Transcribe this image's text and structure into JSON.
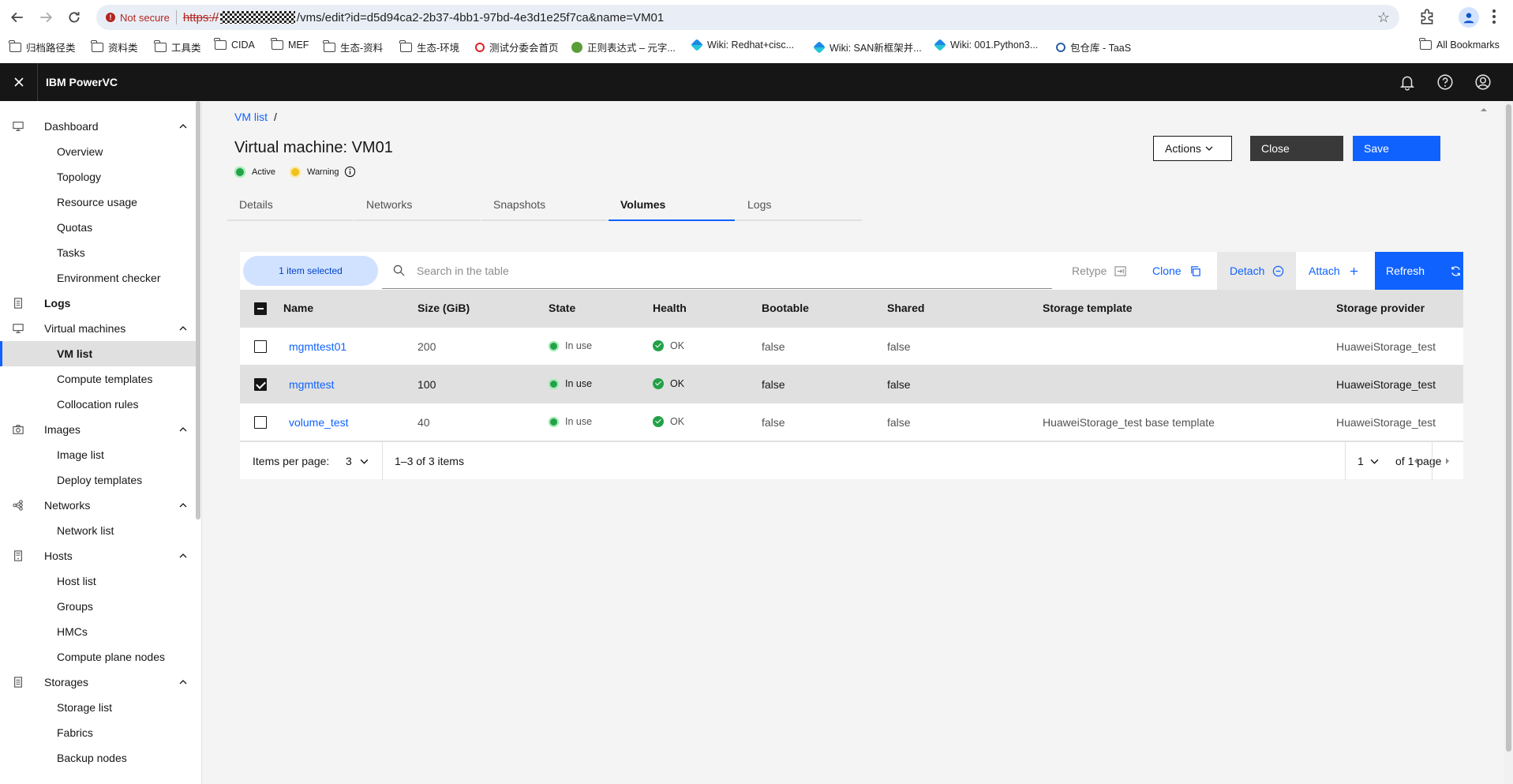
{
  "browser": {
    "not_secure": "Not secure",
    "url_scheme": "https://",
    "url_path": "/vms/edit?id=d5d94ca2-2b37-4bb1-97bd-4e3d1e25f7ca&name=VM01",
    "bookmarks": [
      {
        "label": "归档路径类",
        "icon": "folder-icon"
      },
      {
        "label": "资料类",
        "icon": "folder-icon"
      },
      {
        "label": "工具类",
        "icon": "folder-icon"
      },
      {
        "label": "CIDA",
        "icon": "folder-icon"
      },
      {
        "label": "MEF",
        "icon": "folder-icon"
      },
      {
        "label": "生态-资料",
        "icon": "folder-icon"
      },
      {
        "label": "生态-环境",
        "icon": "folder-icon"
      },
      {
        "label": "测试分委会首页",
        "icon": "huawei-icon"
      },
      {
        "label": "正则表达式 – 元字...",
        "icon": "globe-icon"
      },
      {
        "label": "Wiki: Redhat+cisc...",
        "icon": "wiki-icon"
      },
      {
        "label": "Wiki: SAN新框架并...",
        "icon": "wiki-icon"
      },
      {
        "label": "Wiki: 001.Python3...",
        "icon": "wiki-icon"
      },
      {
        "label": "包仓库 - TaaS",
        "icon": "taas-icon"
      }
    ],
    "all_bookmarks": "All Bookmarks"
  },
  "header": {
    "product": "IBM PowerVC"
  },
  "sidebar": {
    "groups": [
      {
        "label": "Dashboard",
        "icon": "dashboard-icon",
        "items": [
          "Overview",
          "Topology",
          "Resource usage",
          "Quotas",
          "Tasks",
          "Environment checker"
        ]
      },
      {
        "label": "Logs",
        "icon": "logs-icon",
        "items": []
      },
      {
        "label": "Virtual machines",
        "icon": "vm-icon",
        "items": [
          "VM list",
          "Compute templates",
          "Collocation rules"
        ]
      },
      {
        "label": "Images",
        "icon": "camera-icon",
        "items": [
          "Image list",
          "Deploy templates"
        ]
      },
      {
        "label": "Networks",
        "icon": "network-icon",
        "items": [
          "Network list"
        ]
      },
      {
        "label": "Hosts",
        "icon": "host-icon",
        "items": [
          "Host list",
          "Groups",
          "HMCs",
          "Compute plane nodes"
        ]
      },
      {
        "label": "Storages",
        "icon": "storage-icon",
        "items": [
          "Storage list",
          "Fabrics",
          "Backup nodes"
        ]
      }
    ],
    "active_item": "VM list"
  },
  "page": {
    "breadcrumb": "VM list",
    "breadcrumb_sep": "/",
    "title": "Virtual machine: VM01",
    "status_active": "Active",
    "status_warning": "Warning",
    "buttons": {
      "actions": "Actions",
      "close": "Close",
      "save": "Save"
    },
    "tabs": [
      "Details",
      "Networks",
      "Snapshots",
      "Volumes",
      "Logs"
    ],
    "active_tab": "Volumes"
  },
  "table": {
    "selected_text": "1 item selected",
    "search_placeholder": "Search in the table",
    "toolbar": {
      "retype": "Retype",
      "clone": "Clone",
      "detach": "Detach",
      "attach": "Attach",
      "refresh": "Refresh"
    },
    "columns": [
      "Name",
      "Size (GiB)",
      "State",
      "Health",
      "Bootable",
      "Shared",
      "Storage template",
      "Storage provider"
    ],
    "rows": [
      {
        "name": "mgmttest01",
        "size": "200",
        "state": "In use",
        "health": "OK",
        "bootable": "false",
        "shared": "false",
        "template": "",
        "provider": "HuaweiStorage_test",
        "selected": false
      },
      {
        "name": "mgmttest",
        "size": "100",
        "state": "In use",
        "health": "OK",
        "bootable": "false",
        "shared": "false",
        "template": "",
        "provider": "HuaweiStorage_test",
        "selected": true
      },
      {
        "name": "volume_test",
        "size": "40",
        "state": "In use",
        "health": "OK",
        "bootable": "false",
        "shared": "false",
        "template": "HuaweiStorage_test base template",
        "provider": "HuaweiStorage_test",
        "selected": false
      }
    ],
    "pager": {
      "items_per_page_label": "Items per page:",
      "items_per_page": "3",
      "range": "1–3 of 3 items",
      "page": "1",
      "of_pages": "of 1 page"
    }
  }
}
